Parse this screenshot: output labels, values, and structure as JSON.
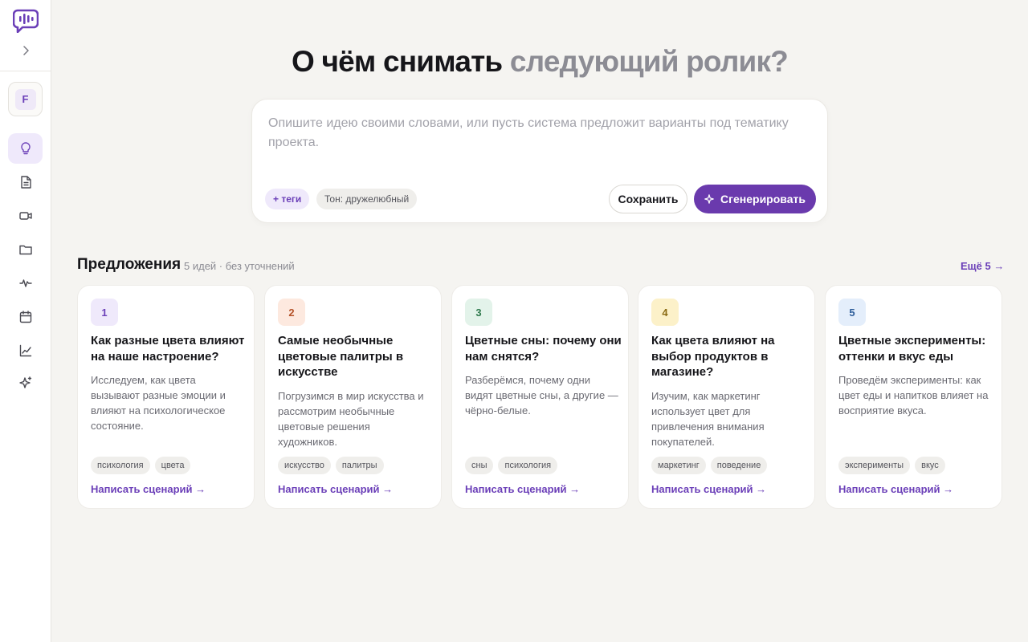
{
  "sidebar": {
    "logo_icon": "chat-bubble-waveform-icon",
    "expand_icon": "chevron-right-icon",
    "workspace_initial": "F",
    "nav": [
      {
        "icon": "lightbulb-icon",
        "active": true
      },
      {
        "icon": "document-icon",
        "active": false
      },
      {
        "icon": "video-camera-icon",
        "active": false
      },
      {
        "icon": "folder-icon",
        "active": false
      },
      {
        "icon": "waveform-icon",
        "active": false
      },
      {
        "icon": "calendar-icon",
        "active": false
      },
      {
        "icon": "line-chart-icon",
        "active": false
      },
      {
        "icon": "sparkle-icon",
        "active": false
      }
    ]
  },
  "headline": {
    "dark": "О чём снимать",
    "light": "следующий ролик?"
  },
  "prompt": {
    "placeholder": "Опишите идею своими словами, или пусть система предложит варианты под тематику проекта.",
    "tags_chip": "+ теги",
    "tone_chip": "Тон: дружелюбный",
    "save_label": "Сохранить",
    "generate_label": "Сгенерировать",
    "generate_icon": "sparkle-icon"
  },
  "suggestions": {
    "title": "Предложения",
    "subtitle": "5 идей · без уточнений",
    "more_label": "Ещё 5 →",
    "cards": [
      {
        "number": "1",
        "title": "Как разные цвета влияют на наше настроение?",
        "description": "Исследуем, как цвета вызывают разные эмоции и влияют на психологическое состояние.",
        "tags": [
          "психология",
          "цвета"
        ],
        "action": "Написать сценарий →",
        "badge_bg": "#efe9fb",
        "badge_color": "#6b3fb8"
      },
      {
        "number": "2",
        "title": "Самые необычные цветовые палитры в искусстве",
        "description": "Погрузимся в мир искусства и рассмотрим необычные цветовые решения художников.",
        "tags": [
          "искусство",
          "палитры"
        ],
        "action": "Написать сценарий →",
        "badge_bg": "#fde9df",
        "badge_color": "#b5532a"
      },
      {
        "number": "3",
        "title": "Цветные сны: почему они нам снятся?",
        "description": "Разберёмся, почему одни видят цветные сны, а другие — чёрно-белые.",
        "tags": [
          "сны",
          "психология"
        ],
        "action": "Написать сценарий →",
        "badge_bg": "#e3f3ea",
        "badge_color": "#2f7a4d"
      },
      {
        "number": "4",
        "title": "Как цвета влияют на выбор продуктов в магазине?",
        "description": "Изучим, как маркетинг использует цвет для привлечения внимания покупателей.",
        "tags": [
          "маркетинг",
          "поведение"
        ],
        "action": "Написать сценарий →",
        "badge_bg": "#fcf1c9",
        "badge_color": "#8a6a12"
      },
      {
        "number": "5",
        "title": "Цветные эксперименты: оттенки и вкус еды",
        "description": "Проведём эксперименты: как цвет еды и напитков влияет на восприятие вкуса.",
        "tags": [
          "эксперименты",
          "вкус"
        ],
        "action": "Написать сценарий →",
        "badge_bg": "#e4eefb",
        "badge_color": "#2d5d9a"
      }
    ]
  }
}
